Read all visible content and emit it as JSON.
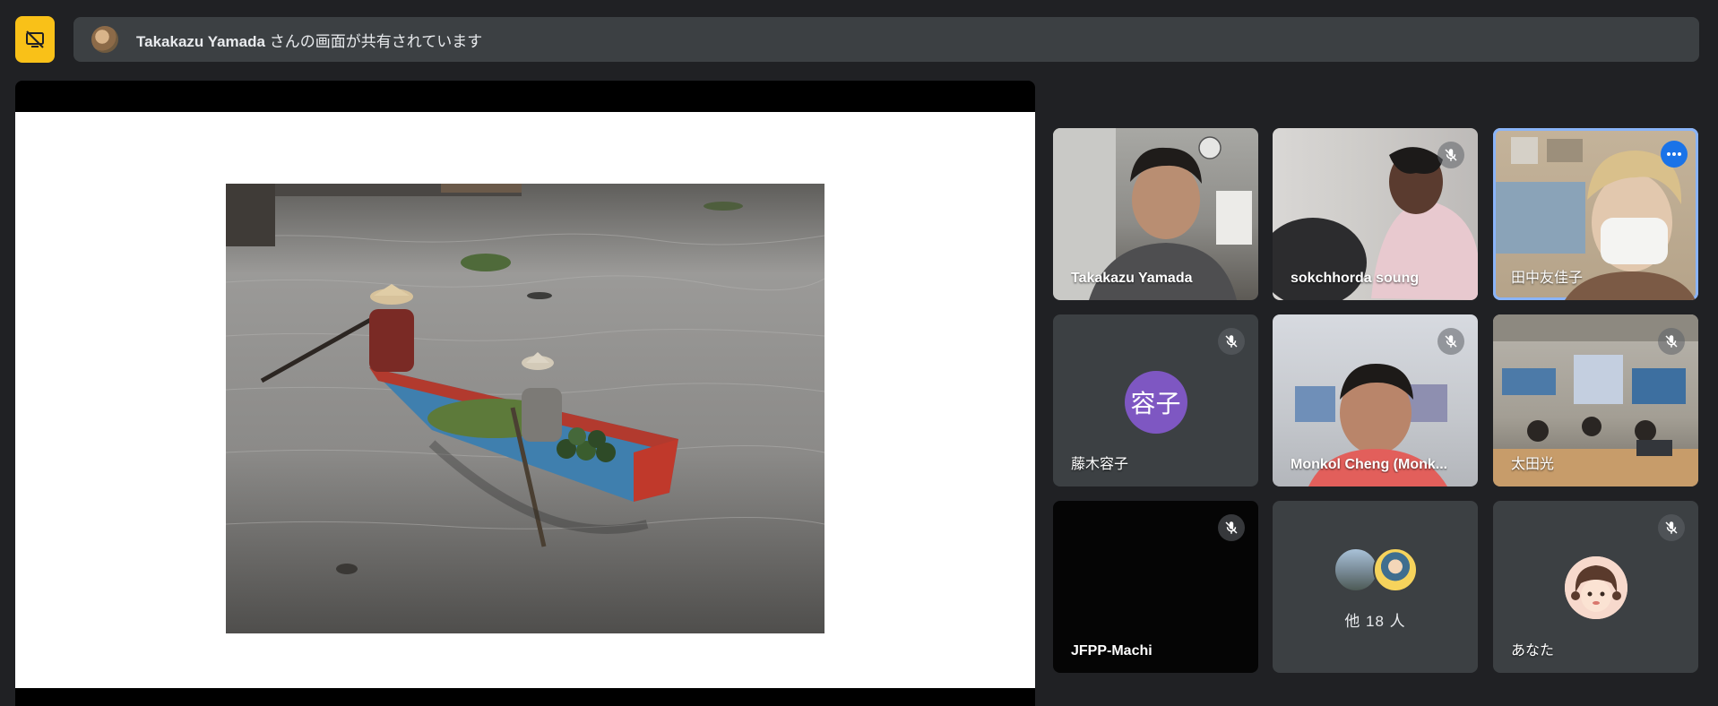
{
  "banner": {
    "presenter_name": "Takakazu Yamada",
    "message": "さんの画面が共有されています"
  },
  "tiles": [
    {
      "name": "Takakazu Yamada",
      "muted": false,
      "active": false
    },
    {
      "name": "sokchhorda soung",
      "muted": true,
      "active": false
    },
    {
      "name": "田中友佳子",
      "muted": false,
      "active": true
    },
    {
      "name": "藤木容子",
      "muted": true,
      "active": false,
      "initial": "容子"
    },
    {
      "name": "Monkol Cheng (Monk...",
      "muted": true,
      "active": false
    },
    {
      "name": "太田光",
      "muted": true,
      "active": false
    },
    {
      "name": "JFPP-Machi",
      "muted": true,
      "active": false
    },
    {
      "name": "他 18 人",
      "muted": false,
      "active": false
    },
    {
      "name": "あなた",
      "muted": true,
      "active": false
    }
  ],
  "icons": {
    "present": "stop-presenting-icon",
    "mute": "mic-off-icon",
    "more": "more-options-icon"
  },
  "colors": {
    "background": "#202124",
    "tile": "#3c4043",
    "present_button": "#f9c118",
    "active_border": "#8ab4f8",
    "accent_blue": "#1a73e8",
    "avatar_purple": "#7e57c2"
  }
}
